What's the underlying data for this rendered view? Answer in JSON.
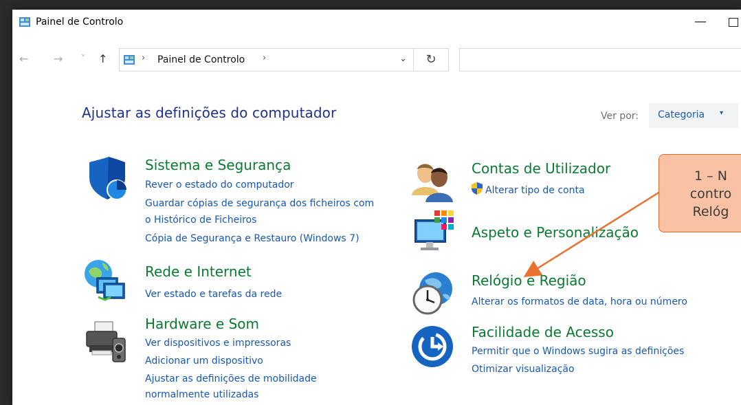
{
  "window": {
    "title": "Painel de Controlo",
    "minimize_glyph": "—"
  },
  "address_bar": {
    "back_glyph": "←",
    "forward_glyph": "→",
    "recent_glyph": "˅",
    "up_glyph": "↑",
    "separator": "›",
    "path": "Painel de Controlo",
    "dropdown_glyph": "⌄",
    "refresh_glyph": "↻"
  },
  "page": {
    "title": "Ajustar as definições do computador",
    "view_by_label": "Ver por:",
    "view_by_value": "Categoria",
    "view_by_caret": "▾"
  },
  "categories_left": [
    {
      "title": "Sistema e Segurança",
      "icon": "security-shield-icon",
      "links": [
        "Rever o estado do computador",
        "Guardar cópias de segurança dos ficheiros com",
        "o Histórico de Ficheiros",
        "Cópia de Segurança e Restauro (Windows 7)"
      ]
    },
    {
      "title": "Rede e Internet",
      "icon": "network-globe-icon",
      "links": [
        "Ver estado e tarefas da rede"
      ]
    },
    {
      "title": "Hardware e Som",
      "icon": "printer-speaker-icon",
      "links": [
        "Ver dispositivos e impressoras",
        "Adicionar um dispositivo",
        "Ajustar as definições de mobilidade",
        "normalmente utilizadas"
      ]
    }
  ],
  "categories_right": [
    {
      "title": "Contas de Utilizador",
      "icon": "users-icon",
      "links": [
        "Alterar tipo de conta"
      ]
    },
    {
      "title": "Aspeto e Personalização",
      "icon": "monitor-palette-icon",
      "links": []
    },
    {
      "title": "Relógio e Região",
      "icon": "clock-globe-icon",
      "links": [
        "Alterar os formatos de data, hora ou número"
      ]
    },
    {
      "title": "Facilidade de Acesso",
      "icon": "ease-of-access-icon",
      "links": [
        "Permitir que o Windows sugira as definições",
        "Otimizar visualização"
      ]
    }
  ],
  "callout": {
    "text": "1 – N\ncontro\nRelóg"
  },
  "colors": {
    "title_blue": "#1e3287",
    "category_green": "#0a7a31",
    "link_blue": "#1657b6",
    "callout_fill": "#f9c2a5",
    "callout_border": "#e06d2b",
    "arrow": "#e8722e"
  }
}
